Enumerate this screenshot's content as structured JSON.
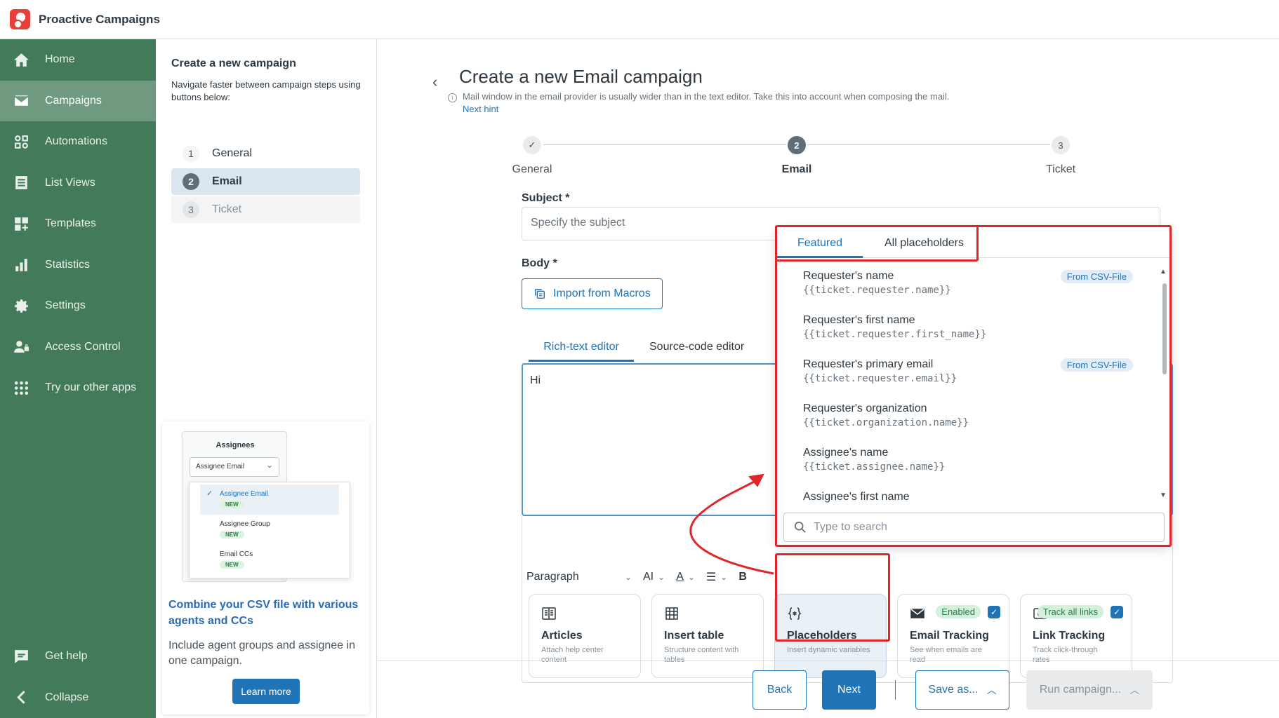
{
  "app": {
    "title": "Proactive Campaigns"
  },
  "nav": {
    "items": [
      {
        "label": "Home",
        "icon": "home-icon"
      },
      {
        "label": "Campaigns",
        "icon": "mail-icon",
        "active": true
      },
      {
        "label": "Automations",
        "icon": "automation-icon"
      },
      {
        "label": "List Views",
        "icon": "list-icon"
      },
      {
        "label": "Templates",
        "icon": "templates-icon"
      },
      {
        "label": "Statistics",
        "icon": "bar-chart-icon"
      },
      {
        "label": "Settings",
        "icon": "gear-icon"
      },
      {
        "label": "Access Control",
        "icon": "user-lock-icon"
      },
      {
        "label": "Try our other apps",
        "icon": "grid-icon"
      }
    ],
    "bottom": [
      {
        "label": "Get help",
        "icon": "chat-icon"
      },
      {
        "label": "Collapse",
        "icon": "chevron-left-icon"
      }
    ]
  },
  "steps_panel": {
    "title": "Create a new campaign",
    "subtitle": "Navigate faster between campaign steps using buttons below:",
    "steps": [
      {
        "num": "1",
        "label": "General"
      },
      {
        "num": "2",
        "label": "Email"
      },
      {
        "num": "3",
        "label": "Ticket"
      }
    ]
  },
  "promo": {
    "mini_title": "Assignees",
    "mini_select": "Assignee Email",
    "options": [
      {
        "label": "Assignee Email",
        "badge": "NEW"
      },
      {
        "label": "Assignee Group",
        "badge": "NEW"
      },
      {
        "label": "Email CCs",
        "badge": "NEW"
      }
    ],
    "headline": "Combine your CSV file with various agents and CCs",
    "text": "Include agent groups and assignee in one campaign.",
    "button": "Learn more"
  },
  "main": {
    "title": "Create a new Email campaign",
    "hint": "Mail window in the email provider is usually wider than in the text editor. Take this into account when composing the mail.",
    "next_hint": "Next hint",
    "stepper": [
      {
        "label": "General",
        "mark": "✓"
      },
      {
        "label": "Email",
        "mark": "2"
      },
      {
        "label": "Ticket",
        "mark": "3"
      }
    ],
    "subject_label": "Subject *",
    "subject_placeholder": "Specify the subject",
    "body_label": "Body *",
    "import_button": "Import from Macros",
    "editor_tabs": [
      "Rich-text editor",
      "Source-code editor"
    ],
    "editor_text": "Hi",
    "toolbar": {
      "paragraph": "Paragraph",
      "ai": "AI",
      "font_color": "A",
      "bold": "B"
    },
    "features": [
      {
        "title": "Articles",
        "desc": "Attach help center content",
        "icon": "article-icon"
      },
      {
        "title": "Insert table",
        "desc": "Structure content with tables",
        "icon": "table-icon"
      },
      {
        "title": "Placeholders",
        "desc": "Insert dynamic variables",
        "icon": "placeholder-icon"
      },
      {
        "title": "Email Tracking",
        "desc": "See when emails are read",
        "icon": "envelope-icon",
        "pill": "Enabled"
      },
      {
        "title": "Link Tracking",
        "desc": "Track click-through rates",
        "icon": "link-icon",
        "pill": "Track all links"
      }
    ]
  },
  "footer": {
    "back": "Back",
    "next": "Next",
    "save": "Save as...",
    "run": "Run campaign..."
  },
  "placeholders": {
    "tabs": [
      "Featured",
      "All placeholders"
    ],
    "items": [
      {
        "name": "Requester's name",
        "code": "{{ticket.requester.name}}",
        "badge": "From CSV-File"
      },
      {
        "name": "Requester's first name",
        "code": "{{ticket.requester.first_name}}"
      },
      {
        "name": "Requester's primary email",
        "code": "{{ticket.requester.email}}",
        "badge": "From CSV-File"
      },
      {
        "name": "Requester's organization",
        "code": "{{ticket.organization.name}}"
      },
      {
        "name": "Assignee's name",
        "code": "{{ticket.assignee.name}}"
      },
      {
        "name": "Assignee's first name",
        "code": ""
      }
    ],
    "search_placeholder": "Type to search"
  },
  "colors": {
    "nav_bg": "#437b5a",
    "accent": "#1f73b7",
    "annotation": "#e0252b"
  }
}
